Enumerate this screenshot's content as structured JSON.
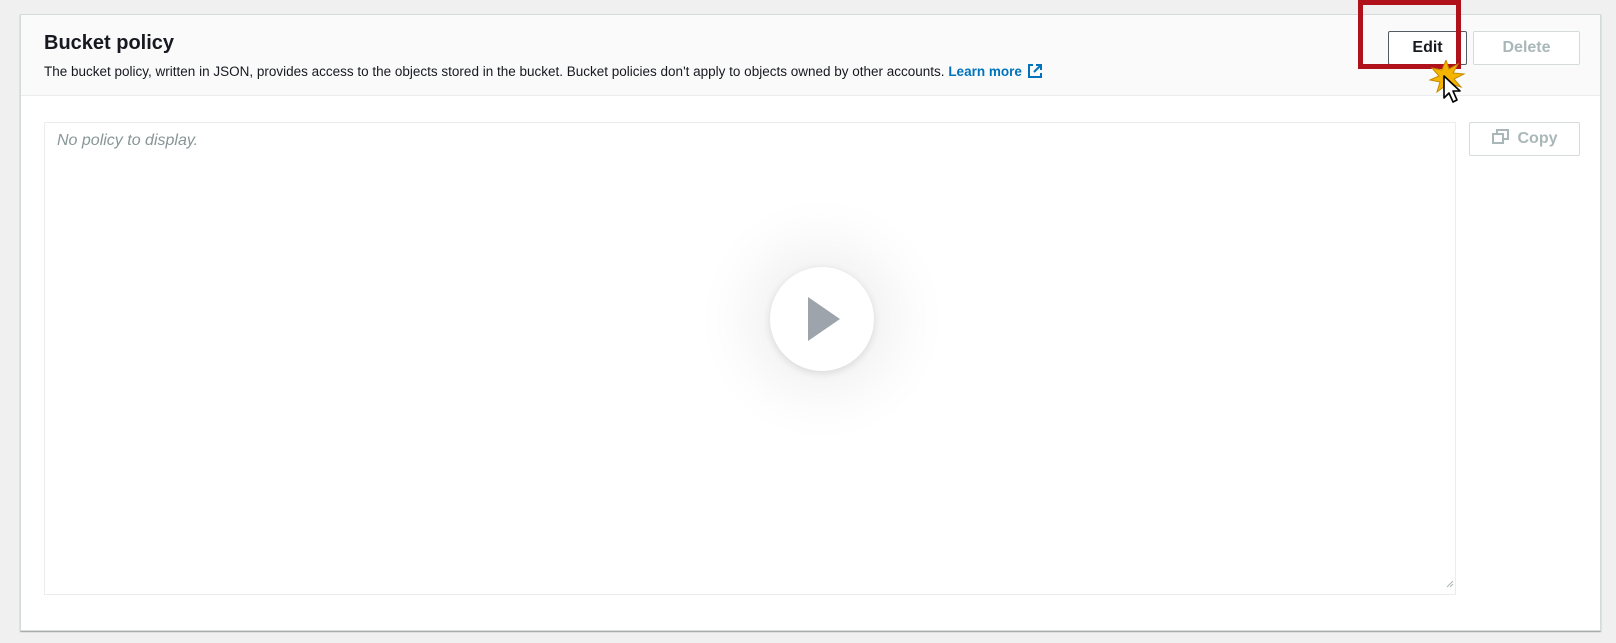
{
  "header": {
    "title": "Bucket policy",
    "description": "The bucket policy, written in JSON, provides access to the objects stored in the bucket. Bucket policies don't apply to objects owned by other accounts. ",
    "learn_more": "Learn more"
  },
  "actions": {
    "edit_label": "Edit",
    "delete_label": "Delete"
  },
  "policy": {
    "placeholder": "No policy to display.",
    "copy_label": "Copy"
  },
  "overlay": {
    "highlight_color": "#b0121b",
    "play_icon": "play-icon",
    "cursor_icon": "arrow-cursor-icon"
  },
  "colors": {
    "link": "#0073bb",
    "text": "#16191f",
    "disabled": "#aab7b8"
  }
}
